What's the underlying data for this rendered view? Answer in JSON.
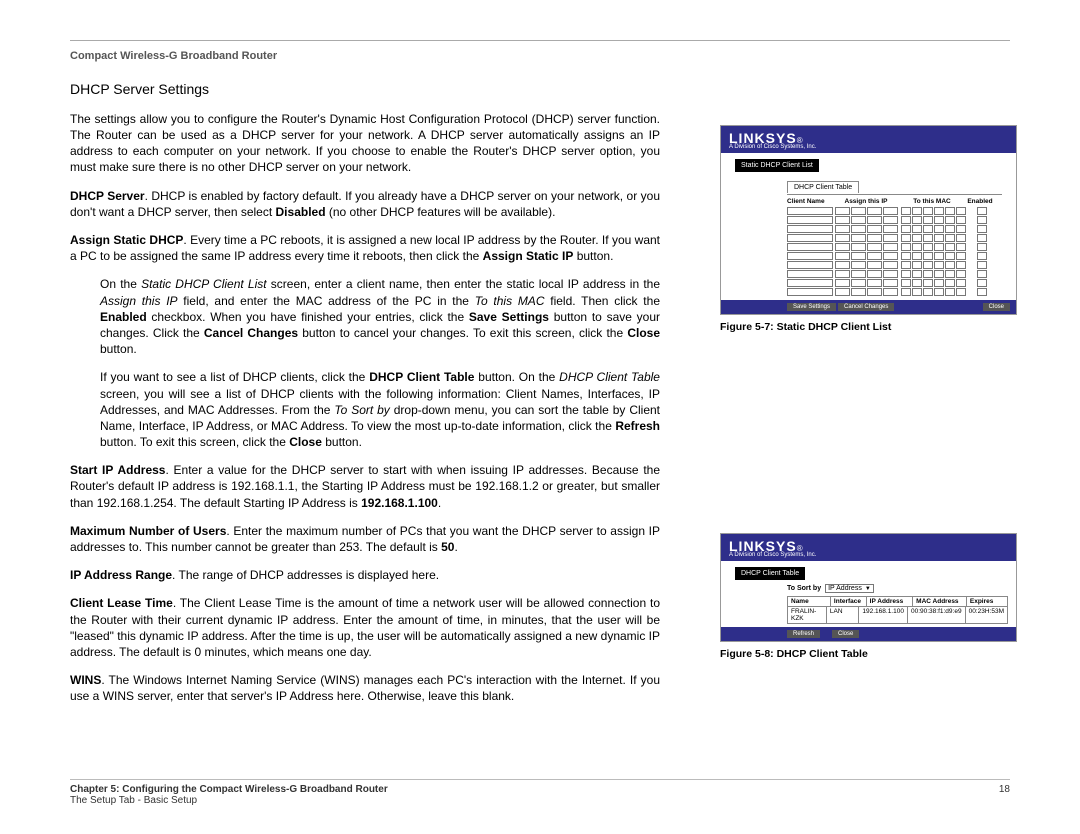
{
  "header": {
    "product": "Compact Wireless-G Broadband Router"
  },
  "section": {
    "title": "DHCP Server Settings"
  },
  "paras": {
    "p1": "The settings allow you to configure the Router's Dynamic Host Configuration Protocol (DHCP) server function. The Router can be used as a DHCP server for your network. A DHCP server automatically assigns an IP address to each computer on your network. If you choose to enable the Router's DHCP server option, you must make sure there is no other DHCP server on your network.",
    "p2a": "DHCP Server",
    "p2b": ". DHCP is enabled by factory default. If you already have a DHCP server on your network, or you don't want a DHCP server, then select ",
    "p2c": "Disabled",
    "p2d": " (no other DHCP features will be available).",
    "p3a": "Assign Static DHCP",
    "p3b": ". Every time a PC reboots, it is assigned a new local IP address by the Router. If you want a PC to be assigned the same IP address every time it reboots, then click the ",
    "p3c": "Assign Static IP",
    "p3d": " button.",
    "p4a": "On the ",
    "p4b": "Static DHCP Client List",
    "p4c": " screen, enter a client name, then enter the static local IP address in the ",
    "p4d": "Assign this IP",
    "p4e": " field, and enter the MAC address of the PC in the ",
    "p4f": "To this MAC",
    "p4g": " field. Then click the ",
    "p4h": "Enabled",
    "p4i": " checkbox. When you have finished your entries, click the ",
    "p4j": "Save Settings",
    "p4k": " button to save your changes. Click the ",
    "p4l": "Cancel Changes",
    "p4m": " button to cancel your changes. To exit this screen, click the ",
    "p4n": "Close",
    "p4o": " button.",
    "p5a": "If you want to see a list of DHCP clients, click the ",
    "p5b": "DHCP Client Table",
    "p5c": " button. On the ",
    "p5d": "DHCP Client Table",
    "p5e": " screen, you will see a list of DHCP clients with the following information: Client Names, Interfaces, IP Addresses, and MAC Addresses. From the ",
    "p5f": "To Sort by",
    "p5g": " drop-down menu, you can sort the table by Client Name, Interface, IP Address, or MAC Address. To view the most up-to-date information, click the ",
    "p5h": "Refresh",
    "p5i": " button. To exit this screen, click the ",
    "p5j": "Close",
    "p5k": " button.",
    "p6a": "Start IP Address",
    "p6b": ". Enter a value for the DHCP server to start with when issuing IP addresses.  Because the Router's default IP address is 192.168.1.1, the Starting IP Address must be 192.168.1.2 or greater, but smaller than 192.168.1.254. The default Starting IP Address is ",
    "p6c": "192.168.1.100",
    "p6d": ".",
    "p7a": "Maximum Number of Users",
    "p7b": ". Enter the maximum number of PCs that you want the DHCP server to assign IP addresses to. This number cannot be greater than 253. The default is ",
    "p7c": "50",
    "p7d": ".",
    "p8a": "IP Address Range",
    "p8b": ". The range of DHCP addresses is displayed here.",
    "p9a": "Client Lease Time",
    "p9b": ". The Client Lease Time is the amount of time a network user will be allowed connection to the Router with their current dynamic IP address. Enter the amount of time, in minutes, that the user will be \"leased\" this dynamic IP address. After the time is up, the user will be automatically assigned a new dynamic IP address. The default is 0 minutes, which means one day.",
    "p10a": "WINS",
    "p10b": ". The Windows Internet Naming Service (WINS) manages each PC's interaction with the Internet. If you use a WINS server, enter that server's IP Address here. Otherwise, leave this blank."
  },
  "fig1": {
    "caption": "Figure 5-7: Static DHCP Client List",
    "brand": "LINKSYS",
    "brand_reg": "®",
    "brand_sub": "A Division of Cisco Systems, Inc.",
    "title_block": "Static DHCP Client List",
    "tab": "DHCP Client Table",
    "cols": {
      "c1": "Client Name",
      "c2": "Assign this IP",
      "c3": "To this MAC",
      "c4": "Enabled"
    },
    "btns": {
      "save": "Save Settings",
      "cancel": "Cancel Changes",
      "close": "Close"
    }
  },
  "fig2": {
    "caption": "Figure 5-8: DHCP Client Table",
    "brand": "LINKSYS",
    "brand_reg": "®",
    "brand_sub": "A Division of Cisco Systems, Inc.",
    "title_block": "DHCP Client Table",
    "sort_label": "To Sort by",
    "sort_value": "IP Address",
    "cols": {
      "c1": "Name",
      "c2": "Interface",
      "c3": "IP Address",
      "c4": "MAC Address",
      "c5": "Expires"
    },
    "row": {
      "c1": "FRALIN-KZK",
      "c2": "LAN",
      "c3": "192.168.1.100",
      "c4": "00:90:38:f1:d9:e9",
      "c5": "00:23H:53M"
    },
    "btns": {
      "refresh": "Refresh",
      "close": "Close"
    }
  },
  "footer": {
    "chapter": "Chapter 5: Configuring the Compact Wireless-G Broadband Router",
    "sub": "The Setup Tab - Basic Setup",
    "page": "18"
  }
}
